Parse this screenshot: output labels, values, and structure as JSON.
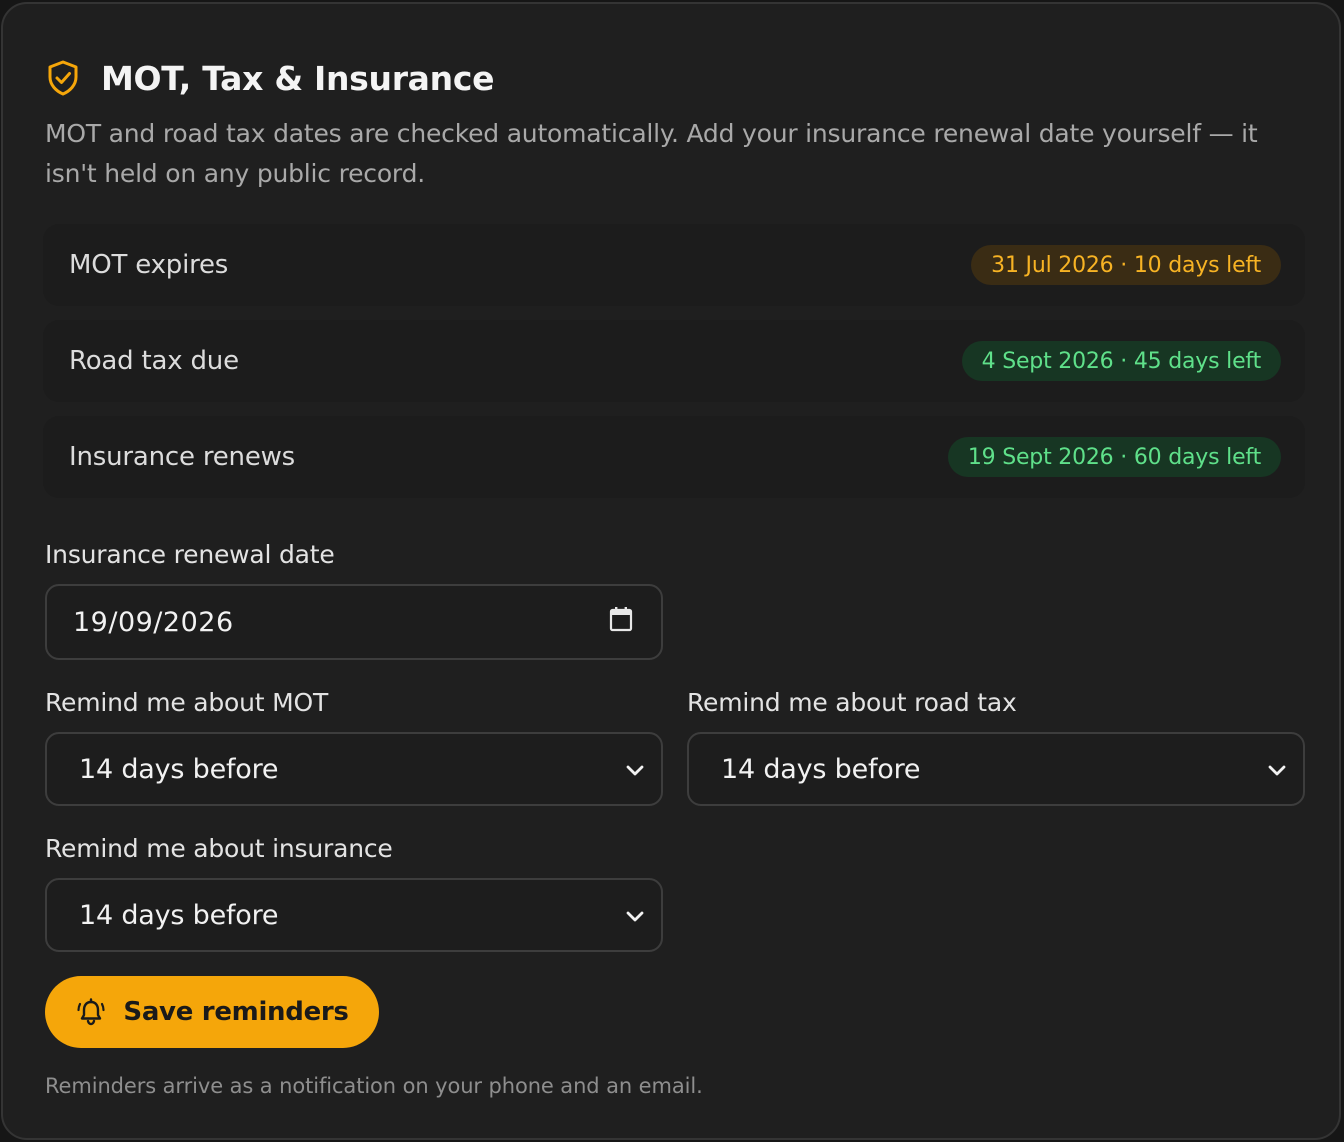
{
  "header": {
    "title": "MOT, Tax & Insurance",
    "icon": "shield-check-icon",
    "description": "MOT and road tax dates are checked automatically. Add your insurance renewal date yourself — it isn't held on any public record."
  },
  "status_rows": [
    {
      "label": "MOT expires",
      "badge": "31 Jul 2026 · 10 days left",
      "status": "warning"
    },
    {
      "label": "Road tax due",
      "badge": "4 Sept 2026 · 45 days left",
      "status": "ok"
    },
    {
      "label": "Insurance renews",
      "badge": "19 Sept 2026 · 60 days left",
      "status": "ok"
    }
  ],
  "insurance_date": {
    "label": "Insurance renewal date",
    "value": "19/09/2026",
    "icon": "calendar-icon"
  },
  "reminders": {
    "mot": {
      "label": "Remind me about MOT",
      "value": "14 days before"
    },
    "road_tax": {
      "label": "Remind me about road tax",
      "value": "14 days before"
    },
    "insurance": {
      "label": "Remind me about insurance",
      "value": "14 days before"
    }
  },
  "save_button": {
    "label": "Save reminders",
    "icon": "bell-icon"
  },
  "footnote": "Reminders arrive as a notification on your phone and an email.",
  "colors": {
    "accent": "#f5a60a",
    "warning_text": "#f7b324",
    "warning_bg": "#3a2c14",
    "ok_text": "#5fe08a",
    "ok_bg": "#173623",
    "card_bg": "#1f1f1f"
  }
}
